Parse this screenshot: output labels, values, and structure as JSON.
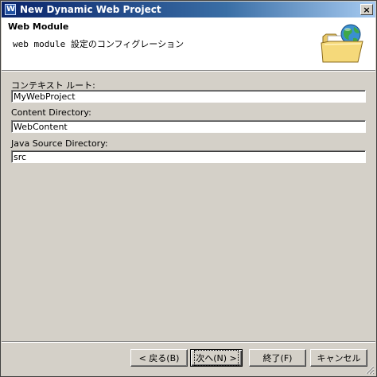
{
  "window": {
    "title": "New Dynamic Web Project",
    "app_icon": "eclipse-wizard-icon",
    "close_glyph": "×"
  },
  "header": {
    "title": "Web Module",
    "description": "web module 設定のコンフィグレーション",
    "banner_icon": "folder-globe-icon"
  },
  "form": {
    "context_root": {
      "label": "コンテキスト ルート:",
      "value": "MyWebProject"
    },
    "content_directory": {
      "label": "Content Directory:",
      "value": "WebContent"
    },
    "java_source_directory": {
      "label": "Java Source Directory:",
      "value": "src"
    }
  },
  "buttons": {
    "back": "< 戻る(B)",
    "next": "次へ(N) >",
    "finish": "終了(F)",
    "cancel": "キャンセル"
  },
  "colors": {
    "titlebar_start": "#0a246a",
    "titlebar_end": "#a6caf0",
    "dialog_bg": "#d4d0c8",
    "header_bg": "#ffffff"
  }
}
